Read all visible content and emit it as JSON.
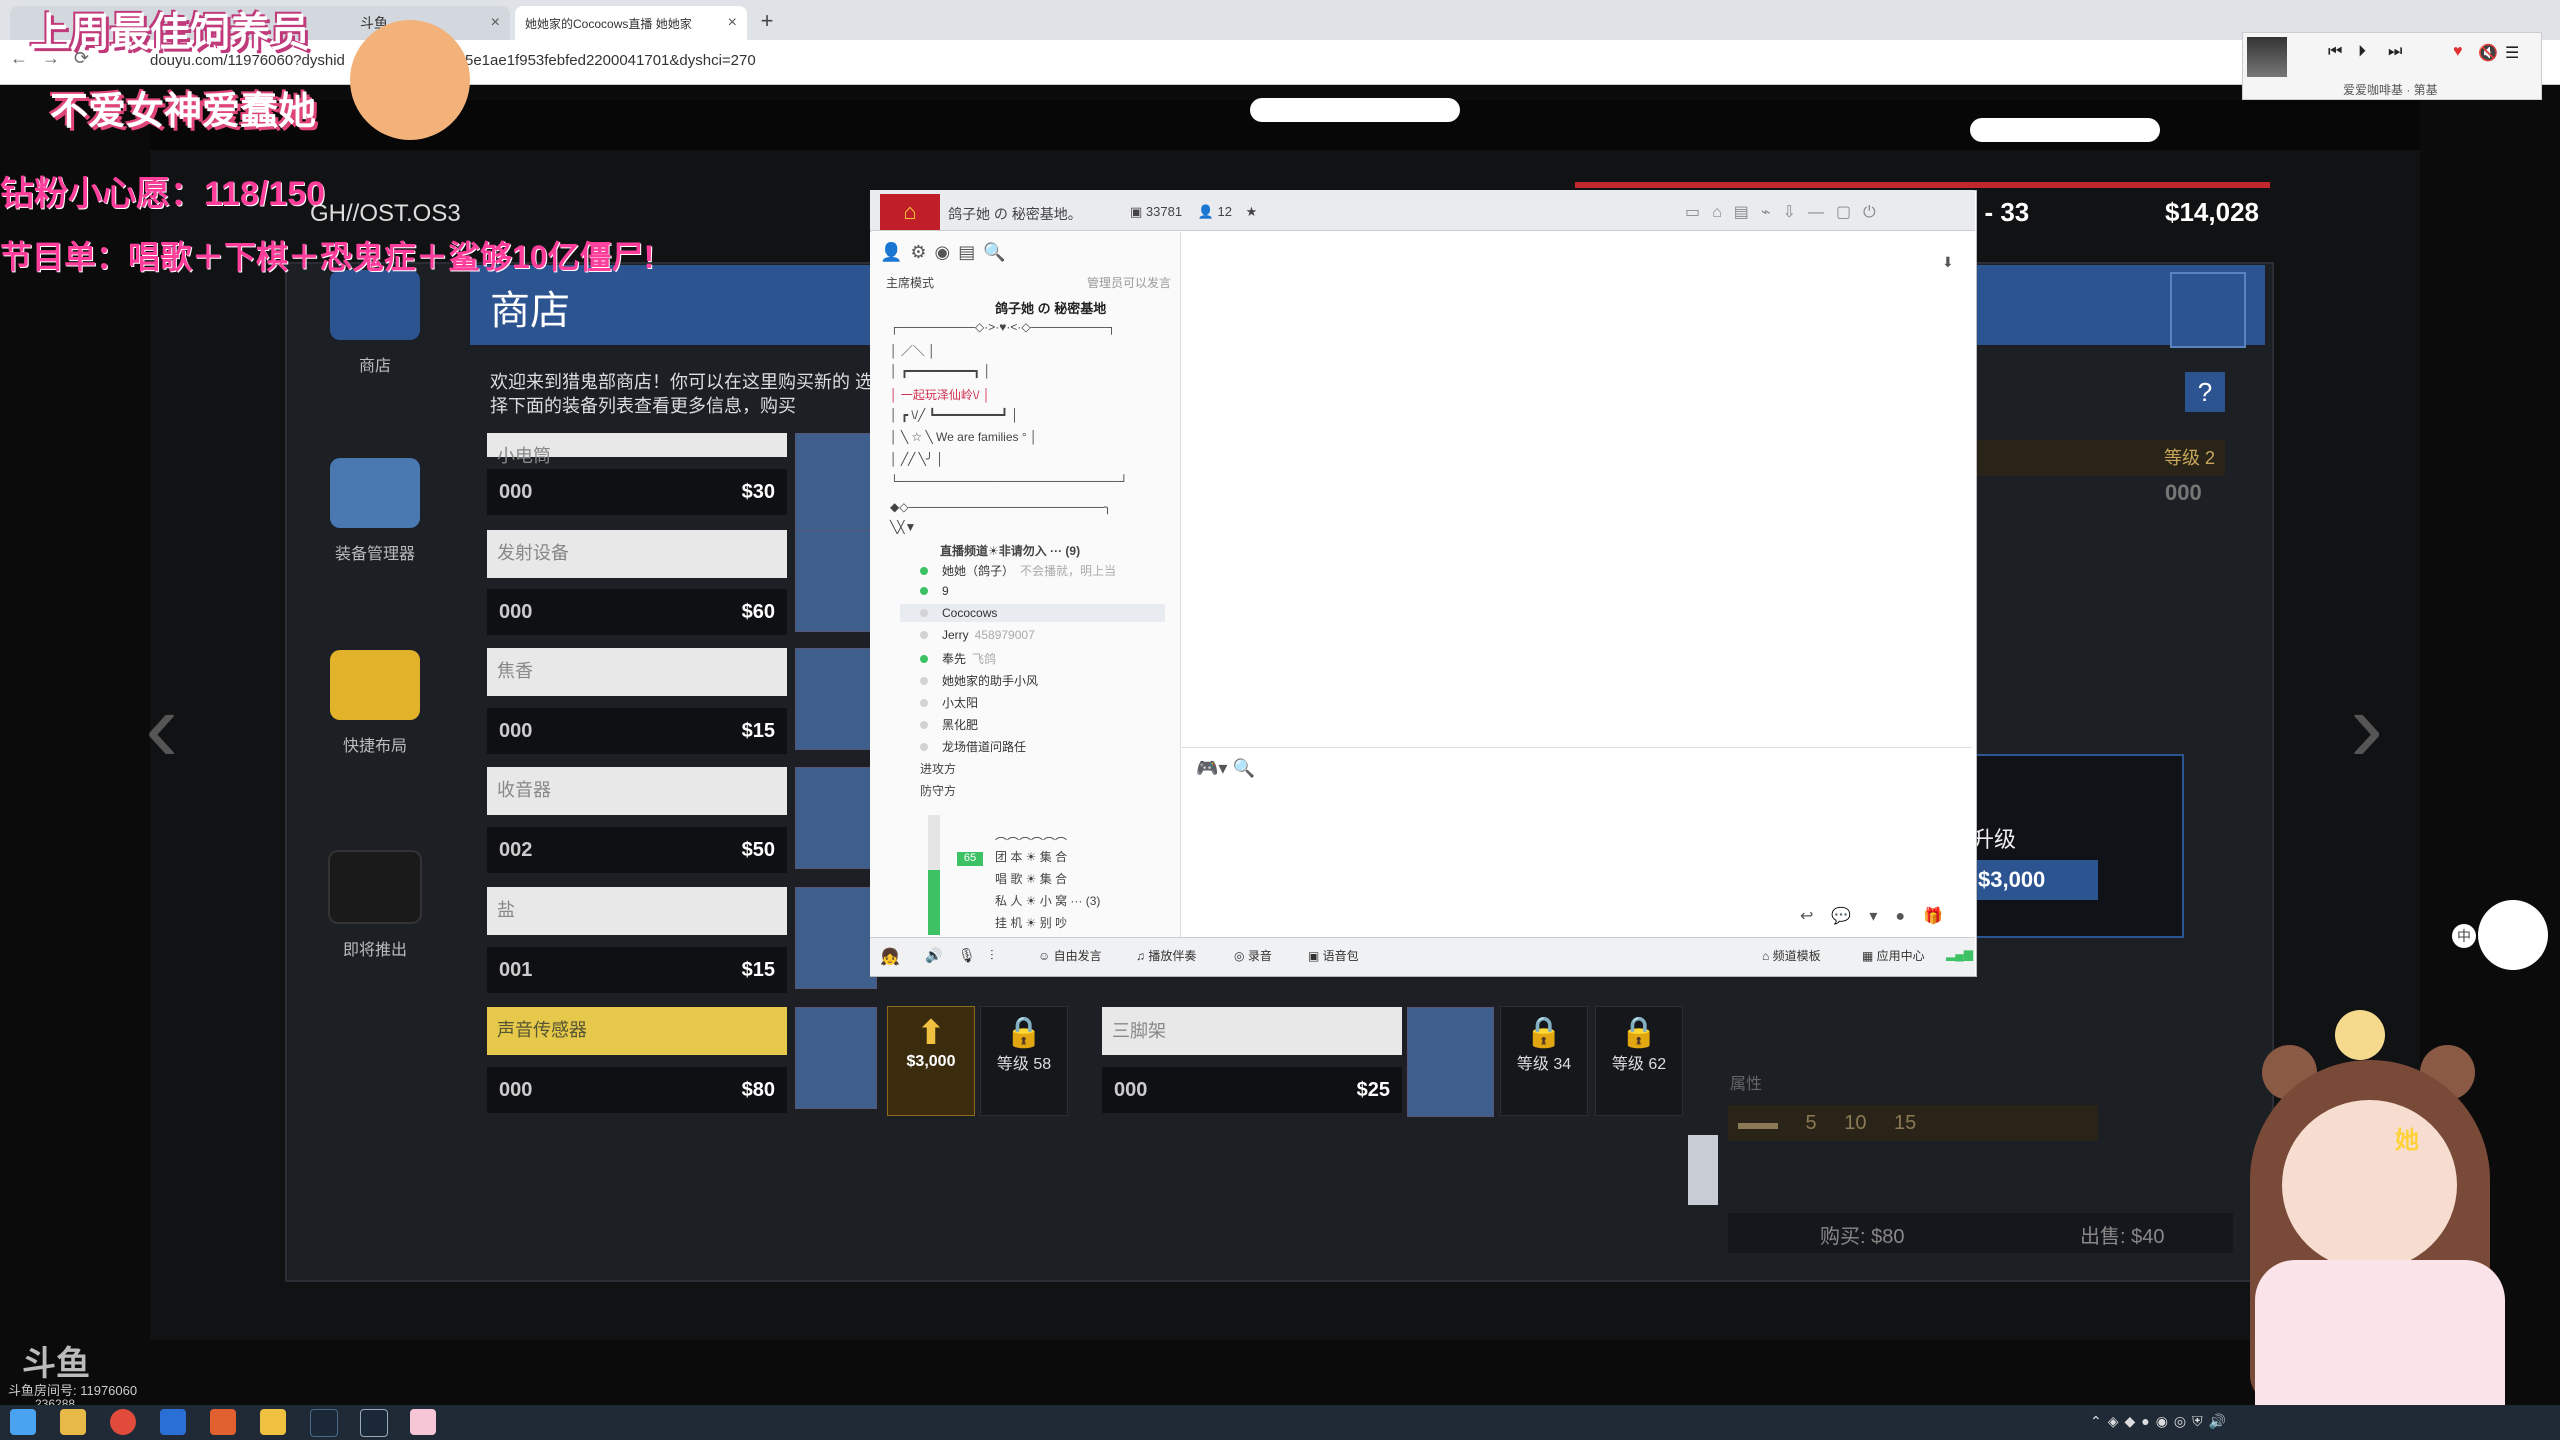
{
  "browser": {
    "tab1_title": "斗鱼",
    "tab2_title": "她她家的Cococows直播 她她家",
    "url_left": "douyu.com/11976060?dyshid",
    "url_right": "5e1ae1f953febfed2200041701&dyshci=270",
    "new_tab": "+",
    "close": "×"
  },
  "player": {
    "song": "爱爱咖啡基 · 第基"
  },
  "overlay": {
    "line1": "上周最佳饲养员",
    "line2": "不爱女神爱蠢她",
    "line3": "钻粉小心愿：118/150",
    "line4": "节目单：唱歌＋下棋＋恐鬼症＋鲨够10亿僵尸!"
  },
  "game": {
    "ghost_label": "GH//OST.OS3",
    "sidebar": [
      {
        "label": "商店",
        "color": "#2c5491"
      },
      {
        "label": "装备管理器",
        "color": "#4a78b0"
      },
      {
        "label": "快捷布局",
        "color": "#e2b22b"
      },
      {
        "label": "即将推出",
        "color": "#1a1a1a"
      }
    ],
    "shop_title": "商店",
    "shop_desc": "欢迎来到猎鬼部商店！你可以在这里购买新的 选择下面的装备列表查看更多信息，购买",
    "items": [
      {
        "name": "小电筒",
        "count": "000",
        "price": "$30"
      },
      {
        "name": "发射设备",
        "count": "000",
        "price": "$60"
      },
      {
        "name": "焦香",
        "count": "000",
        "price": "$15"
      },
      {
        "name": "收音器",
        "count": "002",
        "price": "$50"
      },
      {
        "name": "盐",
        "count": "001",
        "price": "$15"
      },
      {
        "name": "声音传感器",
        "count": "000",
        "price": "$80"
      }
    ],
    "buy_3000": "$3,000",
    "lock_58": "等级 58",
    "lock_34": "等级 34",
    "lock_62": "等级 62",
    "tripod": {
      "name": "三脚架",
      "count": "000",
      "price": "$25"
    },
    "level": "I - 33",
    "money": "$14,028",
    "help": "?",
    "requirement": "等级 2",
    "req_count": "000",
    "upgrade": "升级",
    "upgrade_price": "$3,000",
    "attributes_label": "属性",
    "attributes": "▬▬ 5 10 15",
    "buy": "购买: $80",
    "sell": "出售: $40",
    "arrow_left": "‹",
    "arrow_right": "›"
  },
  "chat": {
    "title": "鸽子她 の 秘密基地。",
    "online": "33781",
    "members_count": "12",
    "mode": "主席模式",
    "admin_note": "管理员可以发言",
    "channel_title": "鸽子她 の 秘密基地",
    "tree": [
      "┌─────────◇·>·♥·<·◇─────────┐",
      "│              ／＼              │",
      "│        ┏━━━━━━━━━┓        │",
      "│        一起玩泽仙岭\\/        │",
      "│ ┏ \\/╱    ┗━━━━━━━━━┛        │",
      "│ ╲ ☆ ╲      We are families °  │",
      "│ ╱╱ ╲╯                            │",
      "└──────────────────────────┘",
      "◆◇───────────────────────╮",
      "╲╳▼"
    ],
    "live_channel": "直播频道☀非请勿入 ··· (9)",
    "members": [
      {
        "name": "她她（鸽子）",
        "note": "不会播就，明上当",
        "online": true
      },
      {
        "name": "9",
        "note": "",
        "online": true
      },
      {
        "name": "Cococows",
        "note": "",
        "online": false
      },
      {
        "name": "Jerry",
        "note": "458979007",
        "online": false
      },
      {
        "name": "奉先",
        "note": "飞鸽",
        "online": true
      },
      {
        "name": "她她家的助手小风",
        "note": "",
        "online": false
      },
      {
        "name": "小太阳",
        "note": "",
        "online": false
      },
      {
        "name": "黑化肥",
        "note": "",
        "online": false
      },
      {
        "name": "龙场借道问路任",
        "note": "",
        "online": false
      }
    ],
    "attack_side": "进攻方",
    "defend_side": "防守方",
    "lower_tree": [
      "︵︵︵︵︵︵",
      "团 本 ☀ 集 合",
      "唱 歌 ☀ 集 合",
      "私 人 ☀ 小 窝 ··· (3)",
      "挂 机 ☀ 别 吵"
    ],
    "mic_level": "65",
    "footer": {
      "free_speak": "自由发言",
      "play_music": "播放伴奏",
      "record": "录音",
      "voice_pack": "语音包",
      "channel_template": "频道模板",
      "app_center": "应用中心"
    }
  },
  "stream": {
    "logo": "斗鱼",
    "room": "斗鱼房间号: 11976060",
    "viewers": "236288"
  }
}
